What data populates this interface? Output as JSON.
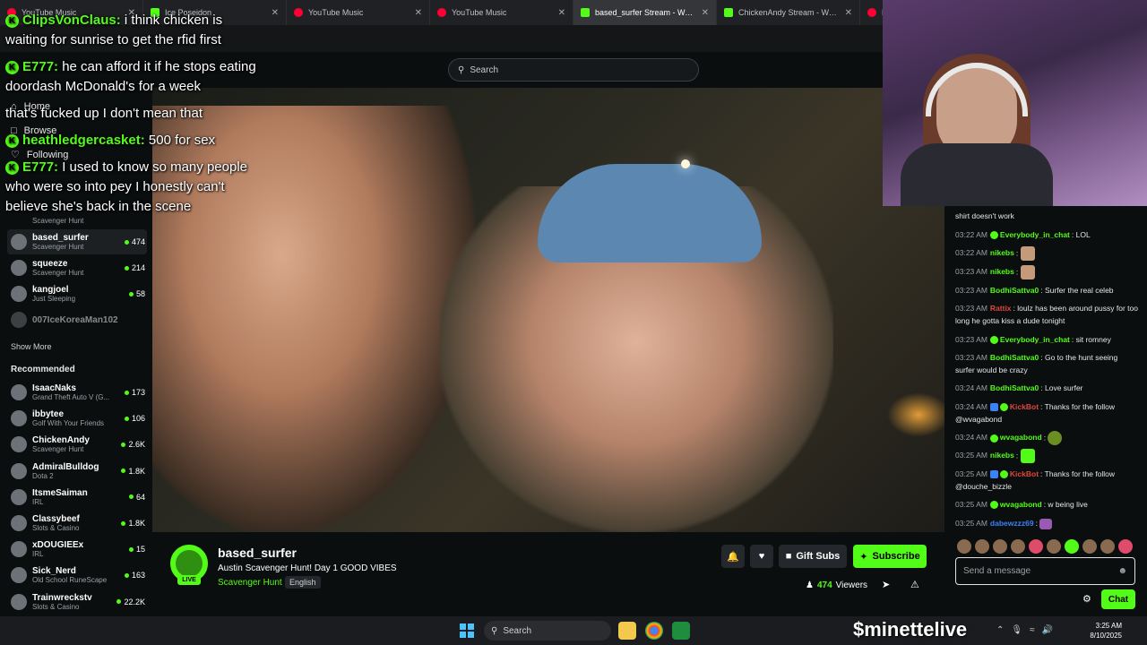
{
  "browser": {
    "tabs": [
      {
        "title": "YouTube Music",
        "icon": "youtube-icon",
        "active": false
      },
      {
        "title": "Ice Poseidon",
        "icon": "kick-icon",
        "active": false
      },
      {
        "title": "YouTube Music",
        "icon": "youtube-icon",
        "active": false
      },
      {
        "title": "YouTube Music",
        "icon": "youtube-icon",
        "active": false
      },
      {
        "title": "based_surfer Stream - Wat...",
        "icon": "kick-icon",
        "active": true
      },
      {
        "title": "ChickenAndy Stream - Wat...",
        "icon": "kick-icon",
        "active": false
      },
      {
        "title": "B",
        "icon": "youtube-icon",
        "active": false
      }
    ]
  },
  "search": {
    "placeholder": "Search"
  },
  "nav": {
    "home": "Home",
    "browse": "Browse",
    "following": "Following"
  },
  "sidebar": {
    "following_channels": [
      {
        "name": "based_surfer",
        "category": "Scavenger Hunt",
        "viewers": "474",
        "active": true
      },
      {
        "name": "squeeze",
        "category": "Scavenger Hunt",
        "viewers": "214",
        "active": false
      },
      {
        "name": "kangjoel",
        "category": "Just Sleeping",
        "viewers": "58",
        "active": false
      },
      {
        "name": "007IceKoreaMan102",
        "category": "",
        "viewers": "",
        "active": false
      }
    ],
    "first_partial_category": "Scavenger Hunt",
    "show_more": "Show More",
    "recommended_heading": "Recommended",
    "recommended": [
      {
        "name": "IsaacNaks",
        "category": "Grand Theft Auto V (G...",
        "viewers": "173"
      },
      {
        "name": "ibbytee",
        "category": "Golf With Your Friends",
        "viewers": "106"
      },
      {
        "name": "ChickenAndy",
        "category": "Scavenger Hunt",
        "viewers": "2.6K"
      },
      {
        "name": "AdmiralBulldog",
        "category": "Dota 2",
        "viewers": "1.8K"
      },
      {
        "name": "ItsmeSaiman",
        "category": "IRL",
        "viewers": "64"
      },
      {
        "name": "Classybeef",
        "category": "Slots & Casino",
        "viewers": "1.8K"
      },
      {
        "name": "xDOUGIEEx",
        "category": "IRL",
        "viewers": "15"
      },
      {
        "name": "Sick_Nerd",
        "category": "Old School RuneScape",
        "viewers": "163"
      },
      {
        "name": "Trainwreckstv",
        "category": "Slots & Casino",
        "viewers": "22.2K"
      }
    ]
  },
  "overlay_chat": [
    {
      "user": "ClipsVonClaus:",
      "text": " i think chicken is"
    },
    {
      "user": "",
      "text": "waiting for sunrise to get the rfid first"
    },
    {
      "user": "E777:",
      "text": " he can afford it if he stops eating"
    },
    {
      "user": "",
      "text": "doordash McDonald's for a week"
    },
    {
      "user": "",
      "text": "that's fucked up I don't mean that"
    },
    {
      "user": "heathledgercasket:",
      "text": " 500 for sex"
    },
    {
      "user": "E777:",
      "text": " I used to know so many people"
    },
    {
      "user": "",
      "text": "who were so into pey I honestly can't"
    },
    {
      "user": "",
      "text": "believe she's back in the scene"
    }
  ],
  "stream": {
    "streamer": "based_surfer",
    "title": "Austin Scavenger Hunt! Day 1 GOOD VIBES",
    "category": "Scavenger Hunt",
    "language": "English",
    "live_label": "LIVE",
    "viewers": "474",
    "viewers_label": "Viewers",
    "gift_subs": "Gift Subs",
    "subscribe": "Subscribe"
  },
  "chat": {
    "partial_top": "shirt doesn't work",
    "messages": [
      {
        "time": "03:22 AM",
        "user": "Everybody_in_chat",
        "color": "#53fc18",
        "text": "LOL",
        "badge": "green"
      },
      {
        "time": "03:22 AM",
        "user": "nikebs",
        "color": "#53fc18",
        "text": "",
        "emote": "face"
      },
      {
        "time": "03:23 AM",
        "user": "nikebs",
        "color": "#53fc18",
        "text": "",
        "emote": "face"
      },
      {
        "time": "03:23 AM",
        "user": "BodhiSattva0",
        "color": "#53fc18",
        "text": "Surfer the real celeb"
      },
      {
        "time": "03:23 AM",
        "user": "Rattix",
        "color": "#e0463c",
        "text": "loulz has been around pussy for too long he gotta kiss a dude tonight"
      },
      {
        "time": "03:23 AM",
        "user": "Everybody_in_chat",
        "color": "#53fc18",
        "text": "sit romney",
        "badge": "green"
      },
      {
        "time": "03:23 AM",
        "user": "BodhiSattva0",
        "color": "#53fc18",
        "text": "Go to the hunt seeing surfer would be crazy"
      },
      {
        "time": "03:24 AM",
        "user": "BodhiSattva0",
        "color": "#53fc18",
        "text": "Love surfer"
      },
      {
        "time": "03:24 AM",
        "user": "KickBot",
        "color": "#e0463c",
        "text": "Thanks for the follow @wvagabond",
        "badge": "bot"
      },
      {
        "time": "03:24 AM",
        "user": "wvagabond",
        "color": "#53fc18",
        "text": "",
        "badge": "green",
        "emote": "c"
      },
      {
        "time": "03:25 AM",
        "user": "nikebs",
        "color": "#53fc18",
        "text": "",
        "emote": "w"
      },
      {
        "time": "03:25 AM",
        "user": "KickBot",
        "color": "#e0463c",
        "text": "Thanks for the follow @douche_bizzle",
        "badge": "bot"
      },
      {
        "time": "03:25 AM",
        "user": "wvagabond",
        "color": "#53fc18",
        "text": "w being live",
        "badge": "green"
      },
      {
        "time": "03:25 AM",
        "user": "dabewzzz69",
        "color": "#3b82f6",
        "text": "",
        "emote": "p"
      }
    ],
    "input_placeholder": "Send a message",
    "send_label": "Chat"
  },
  "taskbar": {
    "search_label": "Search",
    "watermark": "$minettelive",
    "time": "3:25 AM",
    "date": "8/10/2025"
  },
  "colors": {
    "kick_green": "#53fc18",
    "background": "#0b0e0f"
  }
}
